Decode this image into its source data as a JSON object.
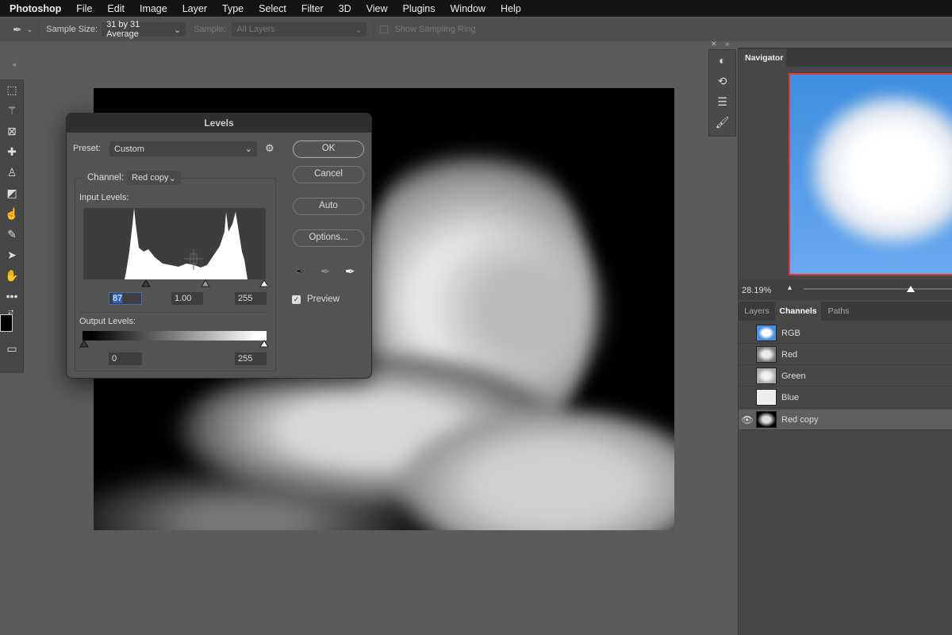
{
  "menubar": {
    "items": [
      "Photoshop",
      "File",
      "Edit",
      "Image",
      "Layer",
      "Type",
      "Select",
      "Filter",
      "3D",
      "View",
      "Plugins",
      "Window",
      "Help"
    ]
  },
  "options": {
    "sample_size_label": "Sample Size:",
    "sample_size_value": "31 by 31 Average",
    "sample_label": "Sample:",
    "sample_value": "All Layers",
    "sampling_ring": "Show Sampling Ring"
  },
  "toolbar": {
    "icons": [
      "marquee-icon",
      "magic-wand-icon",
      "frame-icon",
      "healing-brush-icon",
      "clone-stamp-icon",
      "eraser-icon",
      "smudge-icon",
      "pen-icon",
      "path-selection-icon",
      "hand-icon",
      "more-tools-icon"
    ]
  },
  "levels": {
    "title": "Levels",
    "preset_label": "Preset:",
    "preset_value": "Custom",
    "channel_label": "Channel:",
    "channel_value": "Red copy",
    "input_label": "Input Levels:",
    "input_black": "87",
    "input_gamma": "1.00",
    "input_white": "255",
    "output_label": "Output Levels:",
    "output_black": "0",
    "output_white": "255",
    "ok": "OK",
    "cancel": "Cancel",
    "auto": "Auto",
    "options": "Options...",
    "preview_label": "Preview",
    "preview_checked": true
  },
  "navigator": {
    "tab": "Navigator",
    "zoom": "28.19%",
    "highlight_color": "#e23a3a"
  },
  "channels": {
    "tabs": [
      "Layers",
      "Channels",
      "Paths"
    ],
    "active_tab": "Channels",
    "rows": [
      {
        "name": "RGB",
        "visible": false
      },
      {
        "name": "Red",
        "visible": false
      },
      {
        "name": "Green",
        "visible": false
      },
      {
        "name": "Blue",
        "visible": false
      },
      {
        "name": "Red copy",
        "visible": true,
        "selected": true
      }
    ]
  }
}
